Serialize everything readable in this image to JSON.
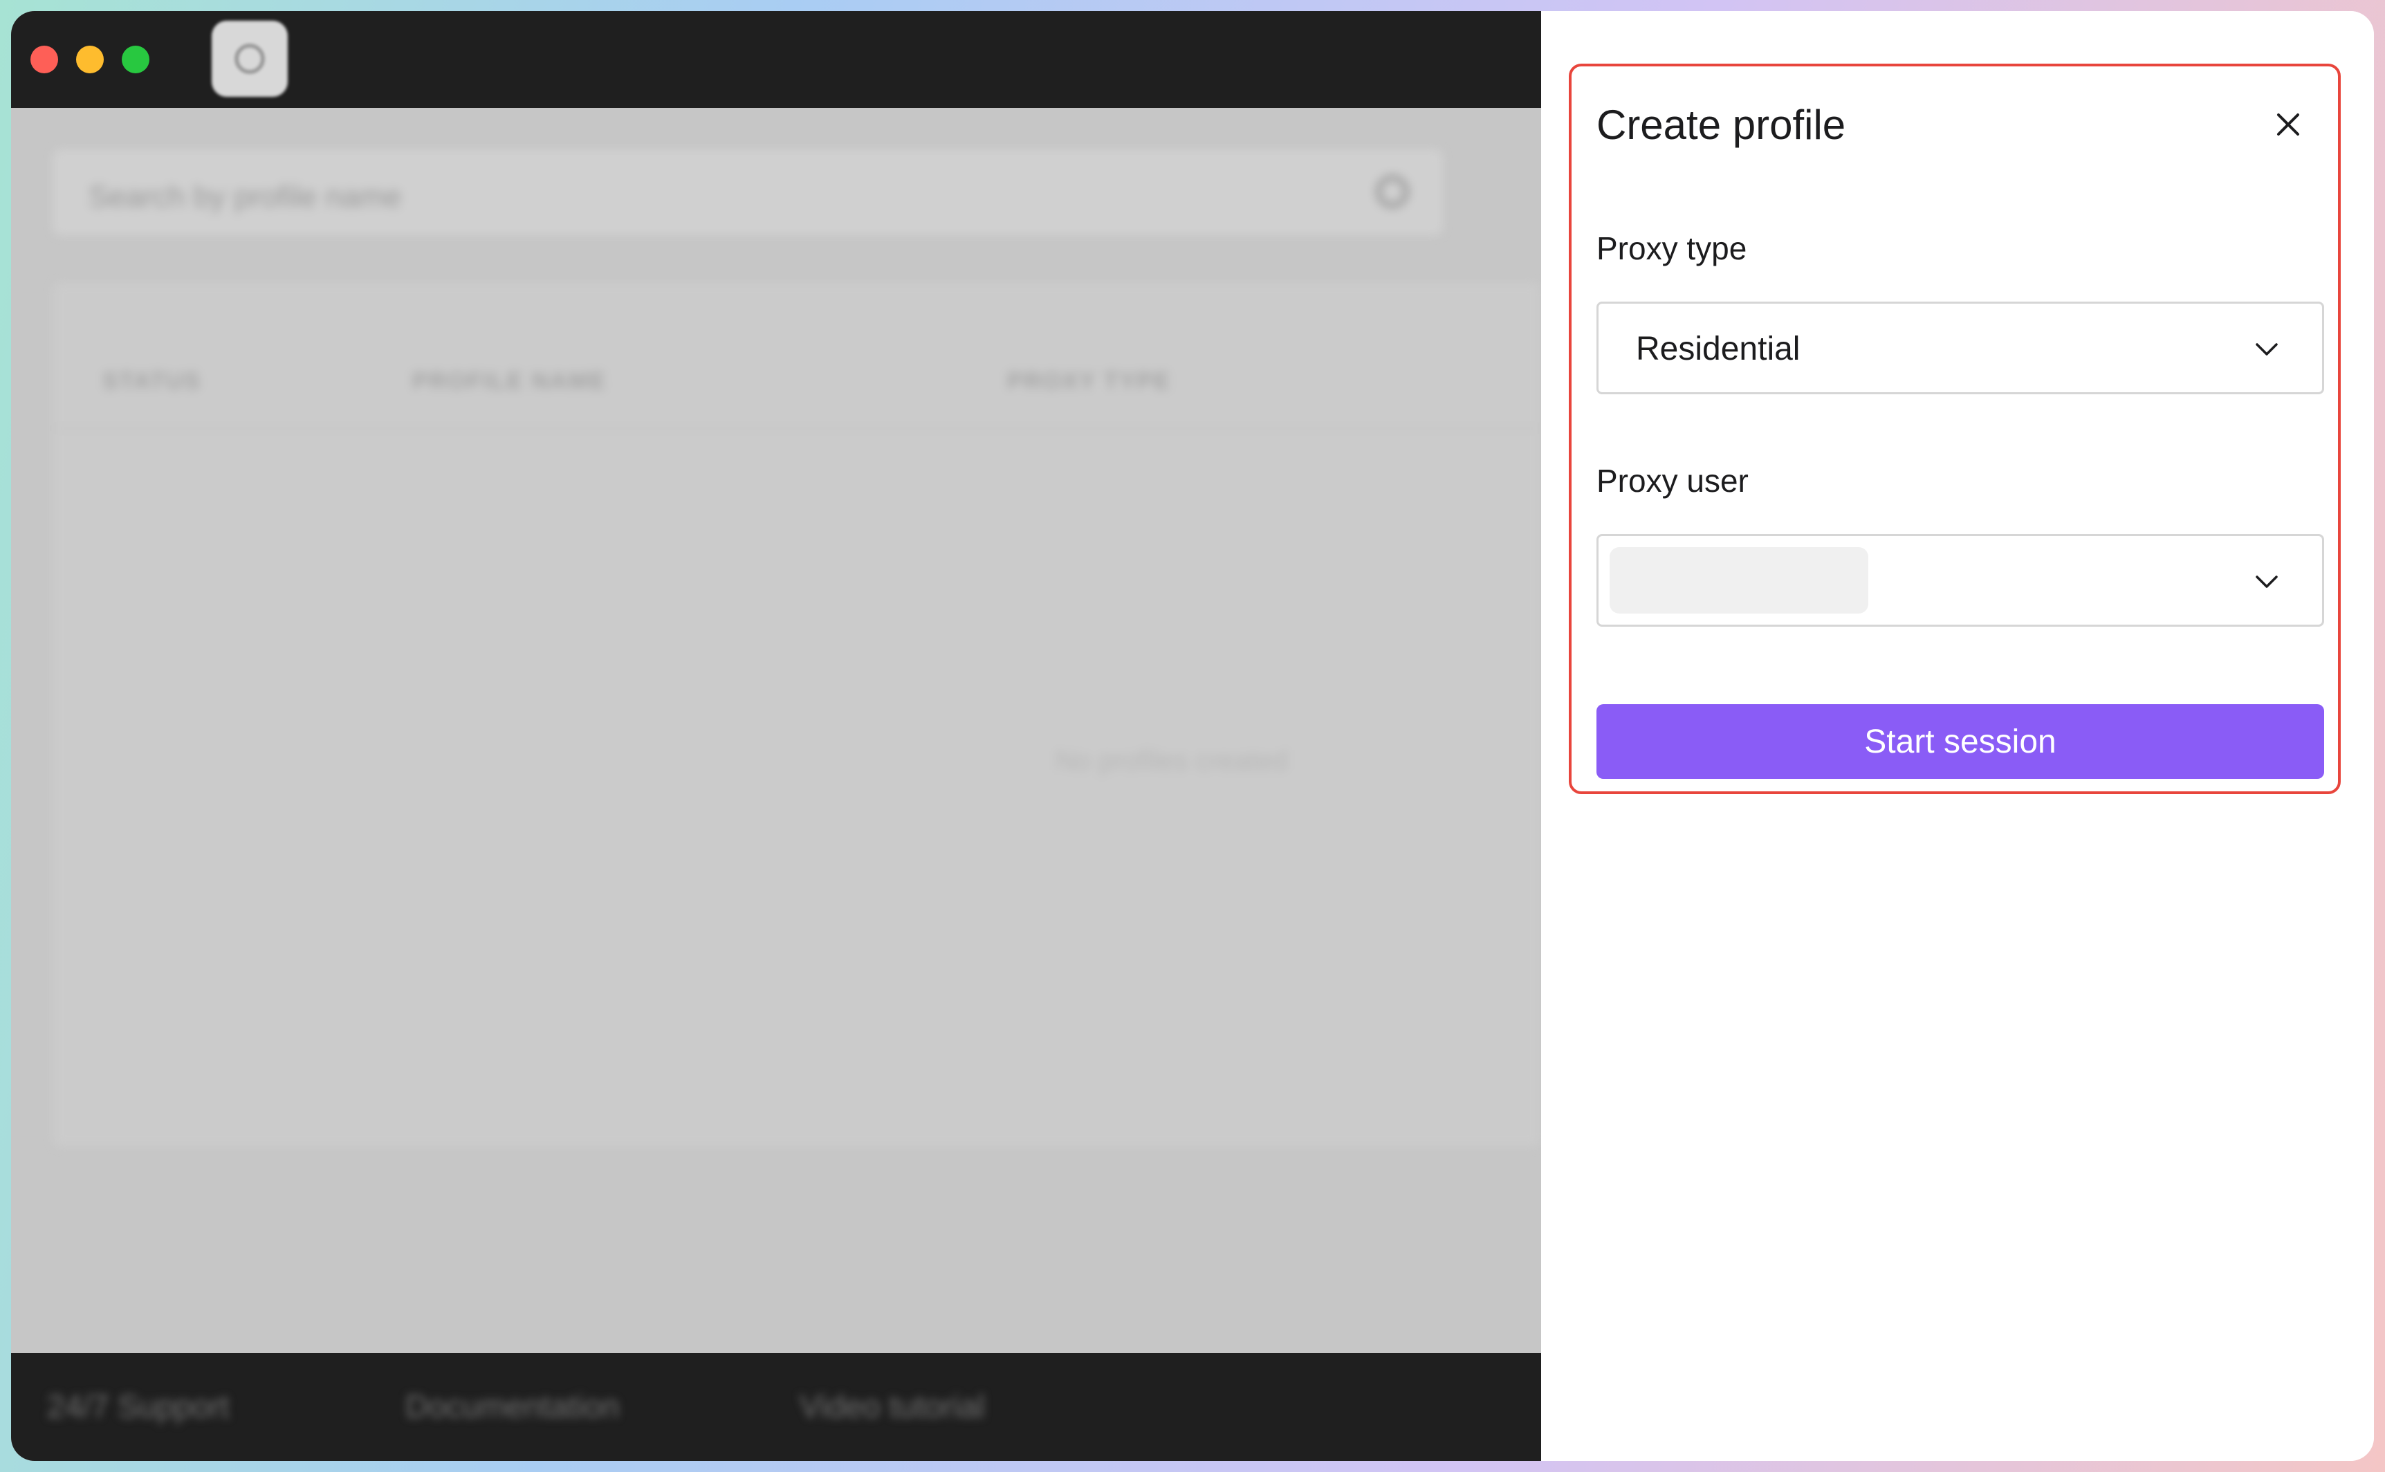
{
  "app": {
    "search": {
      "placeholder": "Search by profile name"
    },
    "table": {
      "columns": [
        "STATUS",
        "PROFILE NAME",
        "PROXY TYPE"
      ],
      "empty_message": "No profiles created"
    },
    "footer": {
      "links": [
        "24/7 Support",
        "Documentation",
        "Video tutorial"
      ]
    }
  },
  "dialog": {
    "title": "Create profile",
    "close_icon": "close-icon",
    "proxy_type": {
      "label": "Proxy type",
      "value": "Residential"
    },
    "proxy_user": {
      "label": "Proxy user",
      "value_redacted": true
    },
    "start_button": "Start session"
  },
  "colors": {
    "accent": "#8a5cf6",
    "highlight_border": "#e8453c",
    "titlebar": "#1f1f1f"
  }
}
